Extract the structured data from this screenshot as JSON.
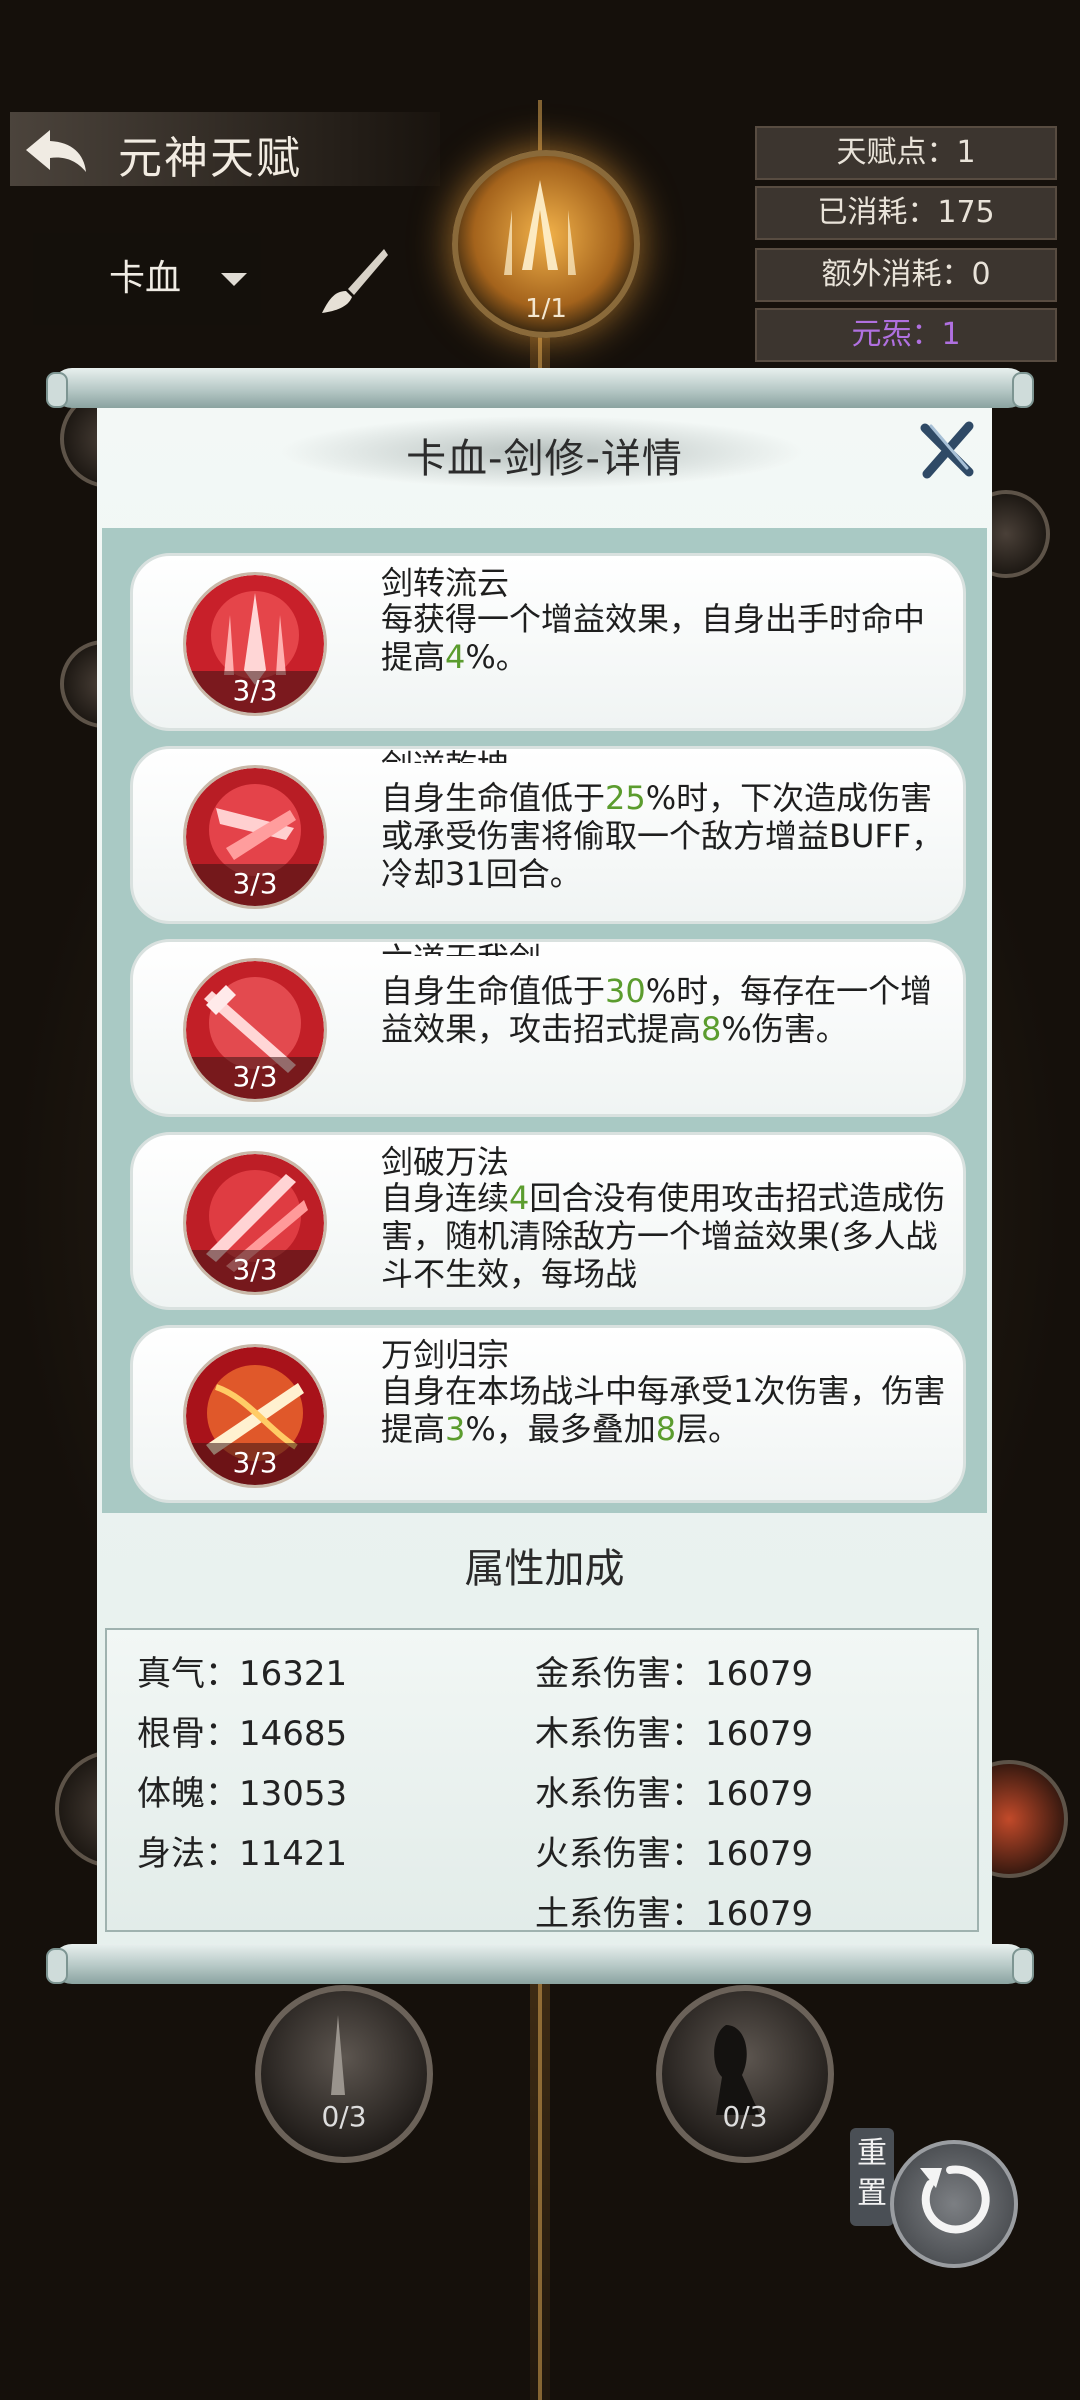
{
  "header": {
    "title": "元神天赋",
    "build_select": "卡血",
    "stats": {
      "talent_points": "天赋点：1",
      "consumed": "已消耗：175",
      "extra_consumed": "额外消耗：0",
      "element": "元炁：1"
    },
    "top_node_count": "1/1"
  },
  "dialog": {
    "title": "卡血-剑修-详情",
    "skills": [
      {
        "name": "剑转流云",
        "level": "3/3",
        "desc": [
          {
            "t": "每获得一个增益效果，自身出手时命中提高"
          },
          {
            "t": "4",
            "hl": true
          },
          {
            "t": "%。"
          }
        ]
      },
      {
        "name": "剑逆乾坤",
        "level": "3/3",
        "desc": [
          {
            "t": "自身生命值低于"
          },
          {
            "t": "25",
            "hl": true
          },
          {
            "t": "%时，下次造成伤害或承受伤害将偷取一个敌方增益BUFF，冷却31回合。"
          }
        ]
      },
      {
        "name": "六道无我剑",
        "level": "3/3",
        "desc": [
          {
            "t": "自身生命值低于"
          },
          {
            "t": "30",
            "hl": true
          },
          {
            "t": "%时，每存在一个增益效果，攻击招式提高"
          },
          {
            "t": "8",
            "hl": true
          },
          {
            "t": "%伤害。"
          }
        ]
      },
      {
        "name": "剑破万法",
        "level": "3/3",
        "desc": [
          {
            "t": "自身连续"
          },
          {
            "t": "4",
            "hl": true
          },
          {
            "t": "回合没有使用攻击招式造成伤害，随机清除敌方一个增益效果(多人战斗不生效，每场战"
          }
        ]
      },
      {
        "name": "万剑归宗",
        "level": "3/3",
        "desc": [
          {
            "t": "自身在本场战斗中每承受1次伤害，伤害提高"
          },
          {
            "t": "3",
            "hl": true
          },
          {
            "t": "%，最多叠加"
          },
          {
            "t": "8",
            "hl": true
          },
          {
            "t": "层。"
          }
        ]
      }
    ],
    "attributes_title": "属性加成",
    "attributes_left": [
      "真气：16321",
      "根骨：14685",
      "体魄：13053",
      "身法：11421"
    ],
    "attributes_right": [
      "金系伤害：16079",
      "木系伤害：16079",
      "水系伤害：16079",
      "火系伤害：16079",
      "土系伤害：16079"
    ]
  },
  "bottom_nodes": [
    {
      "count": "0/3"
    },
    {
      "count": "0/3"
    }
  ],
  "reset_label": "重置",
  "colors": {
    "highlight": "#5b9c2e",
    "element_purple": "#b070e0",
    "panel_bg": "#eef5f3",
    "skill_area_bg": "#a9c9c4"
  },
  "icons": [
    "back-arrow-icon",
    "brush-icon",
    "close-icon",
    "reset-icon",
    "dropdown-caret-icon"
  ]
}
